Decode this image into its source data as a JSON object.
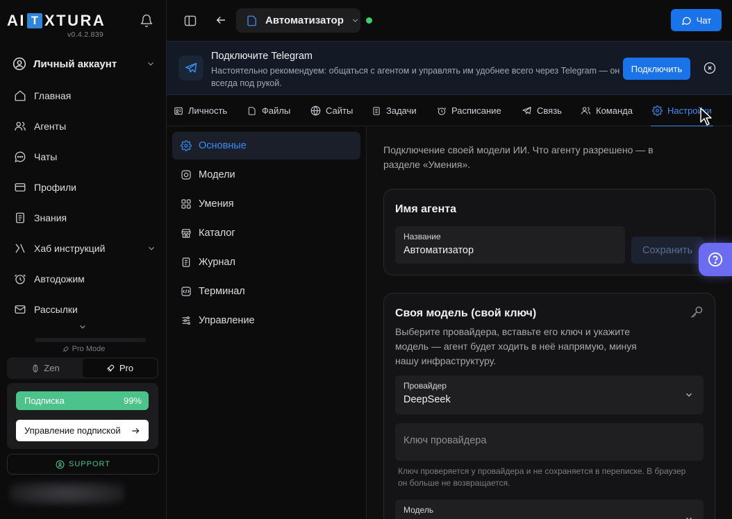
{
  "brand": {
    "logo_left": "AI",
    "logo_t": "T",
    "logo_right": "XTURA",
    "version": "v0.4.2.839"
  },
  "sidebar": {
    "account_label": "Личный аккаунт",
    "items": [
      {
        "label": "Главная",
        "icon": "home-icon"
      },
      {
        "label": "Агенты",
        "icon": "users-icon"
      },
      {
        "label": "Чаты",
        "icon": "chat-icon"
      },
      {
        "label": "Профили",
        "icon": "card-icon"
      },
      {
        "label": "Знания",
        "icon": "book-icon"
      },
      {
        "label": "Хаб инструкций",
        "icon": "hub-icon"
      },
      {
        "label": "Автодожим",
        "icon": "clock-icon"
      },
      {
        "label": "Рассылки",
        "icon": "mail-icon"
      }
    ],
    "pro_mode_label": "Pro Mode",
    "mode_zen": "Zen",
    "mode_pro": "Pro",
    "subscription_label": "Подписка",
    "subscription_percent": "99%",
    "subscription_progress": 0.99,
    "manage_subscription": "Управление подпиской",
    "support": "SUPPORT"
  },
  "topbar": {
    "agent_name": "Автоматизатор",
    "chat_button": "Чат",
    "agent_status": "online"
  },
  "banner": {
    "title": "Подключите Telegram",
    "text": "Настоятельно рекомендуем: общаться с агентом и управлять им удобнее всего через Telegram — он всегда под рукой.",
    "connect_button": "Подключить"
  },
  "tabs": [
    {
      "label": "Личность",
      "icon": "persona-icon"
    },
    {
      "label": "Файлы",
      "icon": "file-icon"
    },
    {
      "label": "Сайты",
      "icon": "globe-icon"
    },
    {
      "label": "Задачи",
      "icon": "tasks-icon"
    },
    {
      "label": "Расписание",
      "icon": "clock-icon"
    },
    {
      "label": "Связь",
      "icon": "send-icon"
    },
    {
      "label": "Команда",
      "icon": "team-icon"
    },
    {
      "label": "Настройки",
      "icon": "gear-icon",
      "active": true
    }
  ],
  "settings_nav": [
    {
      "label": "Основные",
      "icon": "gear-icon",
      "active": true
    },
    {
      "label": "Модели",
      "icon": "model-icon"
    },
    {
      "label": "Умения",
      "icon": "grid-icon"
    },
    {
      "label": "Каталог",
      "icon": "store-icon"
    },
    {
      "label": "Журнал",
      "icon": "log-icon"
    },
    {
      "label": "Терминал",
      "icon": "terminal-icon"
    },
    {
      "label": "Управление",
      "icon": "sliders-icon"
    }
  ],
  "main": {
    "intro": "Подключение своей модели ИИ. Что агенту разрешено — в разделе «Умения».",
    "name_card": {
      "title": "Имя агента",
      "field_label": "Название",
      "field_value": "Автоматизатор",
      "save_button": "Сохранить"
    },
    "model_card": {
      "title": "Своя модель (свой ключ)",
      "description": "Выберите провайдера, вставьте его ключ и укажите модель — агент будет ходить в неё напрямую, минуя нашу инфраструктуру.",
      "provider_label": "Провайдер",
      "provider_value": "DeepSeek",
      "key_placeholder": "Ключ провайдера",
      "key_hint": "Ключ проверяется у провайдера и не сохраняется в переписке. В браузер он больше не возвращается.",
      "model_label": "Модель"
    }
  },
  "colors": {
    "accent": "#1a73e8",
    "active_tab": "#3b8cf5",
    "success": "#4cc38a",
    "online": "#3ecf6a",
    "help": "#6c6cf0"
  }
}
